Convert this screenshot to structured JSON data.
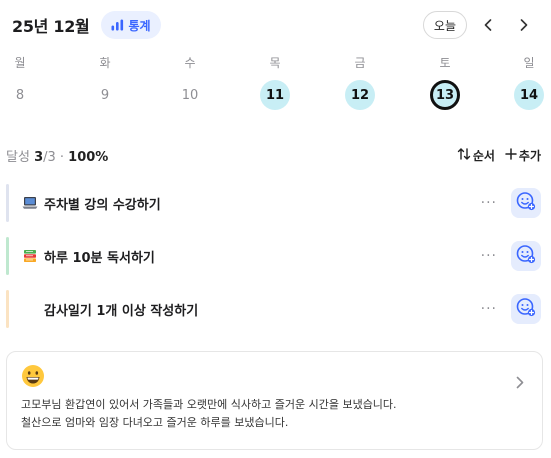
{
  "header": {
    "month_title": "25년 12월",
    "stats_label": "통계",
    "today_label": "오늘"
  },
  "week": [
    {
      "name": "월",
      "num": "8",
      "state": "none"
    },
    {
      "name": "화",
      "num": "9",
      "state": "none"
    },
    {
      "name": "수",
      "num": "10",
      "state": "none"
    },
    {
      "name": "목",
      "num": "11",
      "state": "done"
    },
    {
      "name": "금",
      "num": "12",
      "state": "done"
    },
    {
      "name": "토",
      "num": "13",
      "state": "selected"
    },
    {
      "name": "일",
      "num": "14",
      "state": "done"
    }
  ],
  "progress": {
    "prefix": "달성 ",
    "done": "3",
    "total": "/3",
    "sep": " · ",
    "percent": "100%"
  },
  "actions": {
    "sort_label": "순서",
    "add_label": "추가"
  },
  "tasks": [
    {
      "label": "주차별 강의 수강하기",
      "icon": "laptop-icon",
      "bar_color": "#dfe3ef"
    },
    {
      "label": "하루 10분 독서하기",
      "icon": "books-icon",
      "bar_color": "#bfe8cf"
    },
    {
      "label": "감사일기 1개 이상 작성하기",
      "icon": "none",
      "bar_color": "#fbe3c2"
    }
  ],
  "diary": {
    "emoji": "grinning-face-icon",
    "line1": "고모부님 환갑연이 있어서 가족들과 오랫만에 식사하고 즐거운 시간을 보냈습니다.",
    "line2": "철산으로 엄마와 임장 다녀오고 즐거운 하루를 보냈습니다."
  },
  "colors": {
    "accent": "#3a66ff",
    "done_day": "#c8eef5",
    "react_bg": "#e5ecfd"
  }
}
